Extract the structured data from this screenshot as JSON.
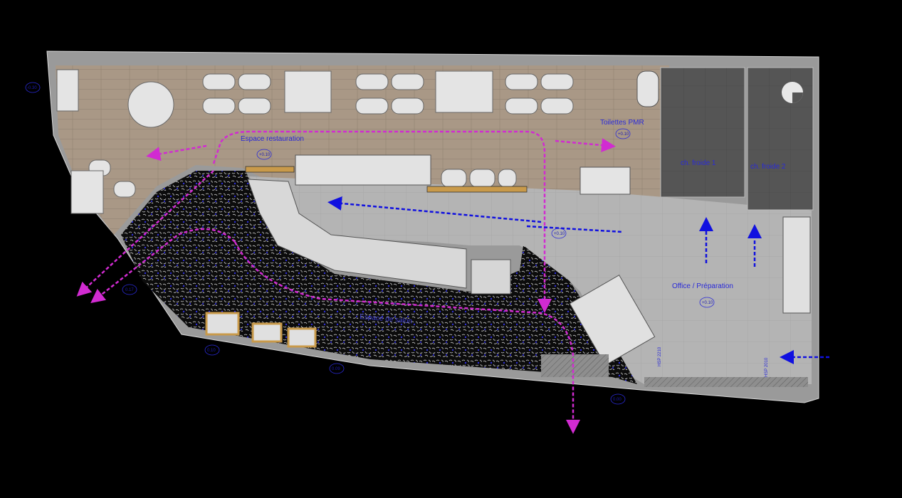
{
  "rooms": {
    "restaurant": "Espace restauration",
    "toilets": "Toilettes PMR",
    "cold_room_1": "ch. froide 1",
    "cold_room_2": "ch. froide 2",
    "office": "Office / Préparation",
    "terrace": "Espace de salon"
  },
  "levels": {
    "nw": "-0.30",
    "restaurant": "+0.10",
    "toilets": "+0.10",
    "bar": "+0.10",
    "office": "+0.10",
    "w_entry": "0.17",
    "sw": "0.10",
    "s": "0.09",
    "se": "0.00"
  },
  "heights": {
    "hsp_a": "HSP 2210",
    "hsp_b": "HSP 2010"
  },
  "colors": {
    "background": "#000000",
    "wood_floor": "#a99886",
    "tile_floor": "#b4b4b4",
    "cold_room_floor": "#555555",
    "flow_magenta": "#d12bd1",
    "flow_blue": "#1010e0",
    "wall": "#9a9a9a"
  },
  "icons": [
    "north-arrow-icon",
    "flow-arrow-magenta",
    "flow-arrow-blue"
  ]
}
